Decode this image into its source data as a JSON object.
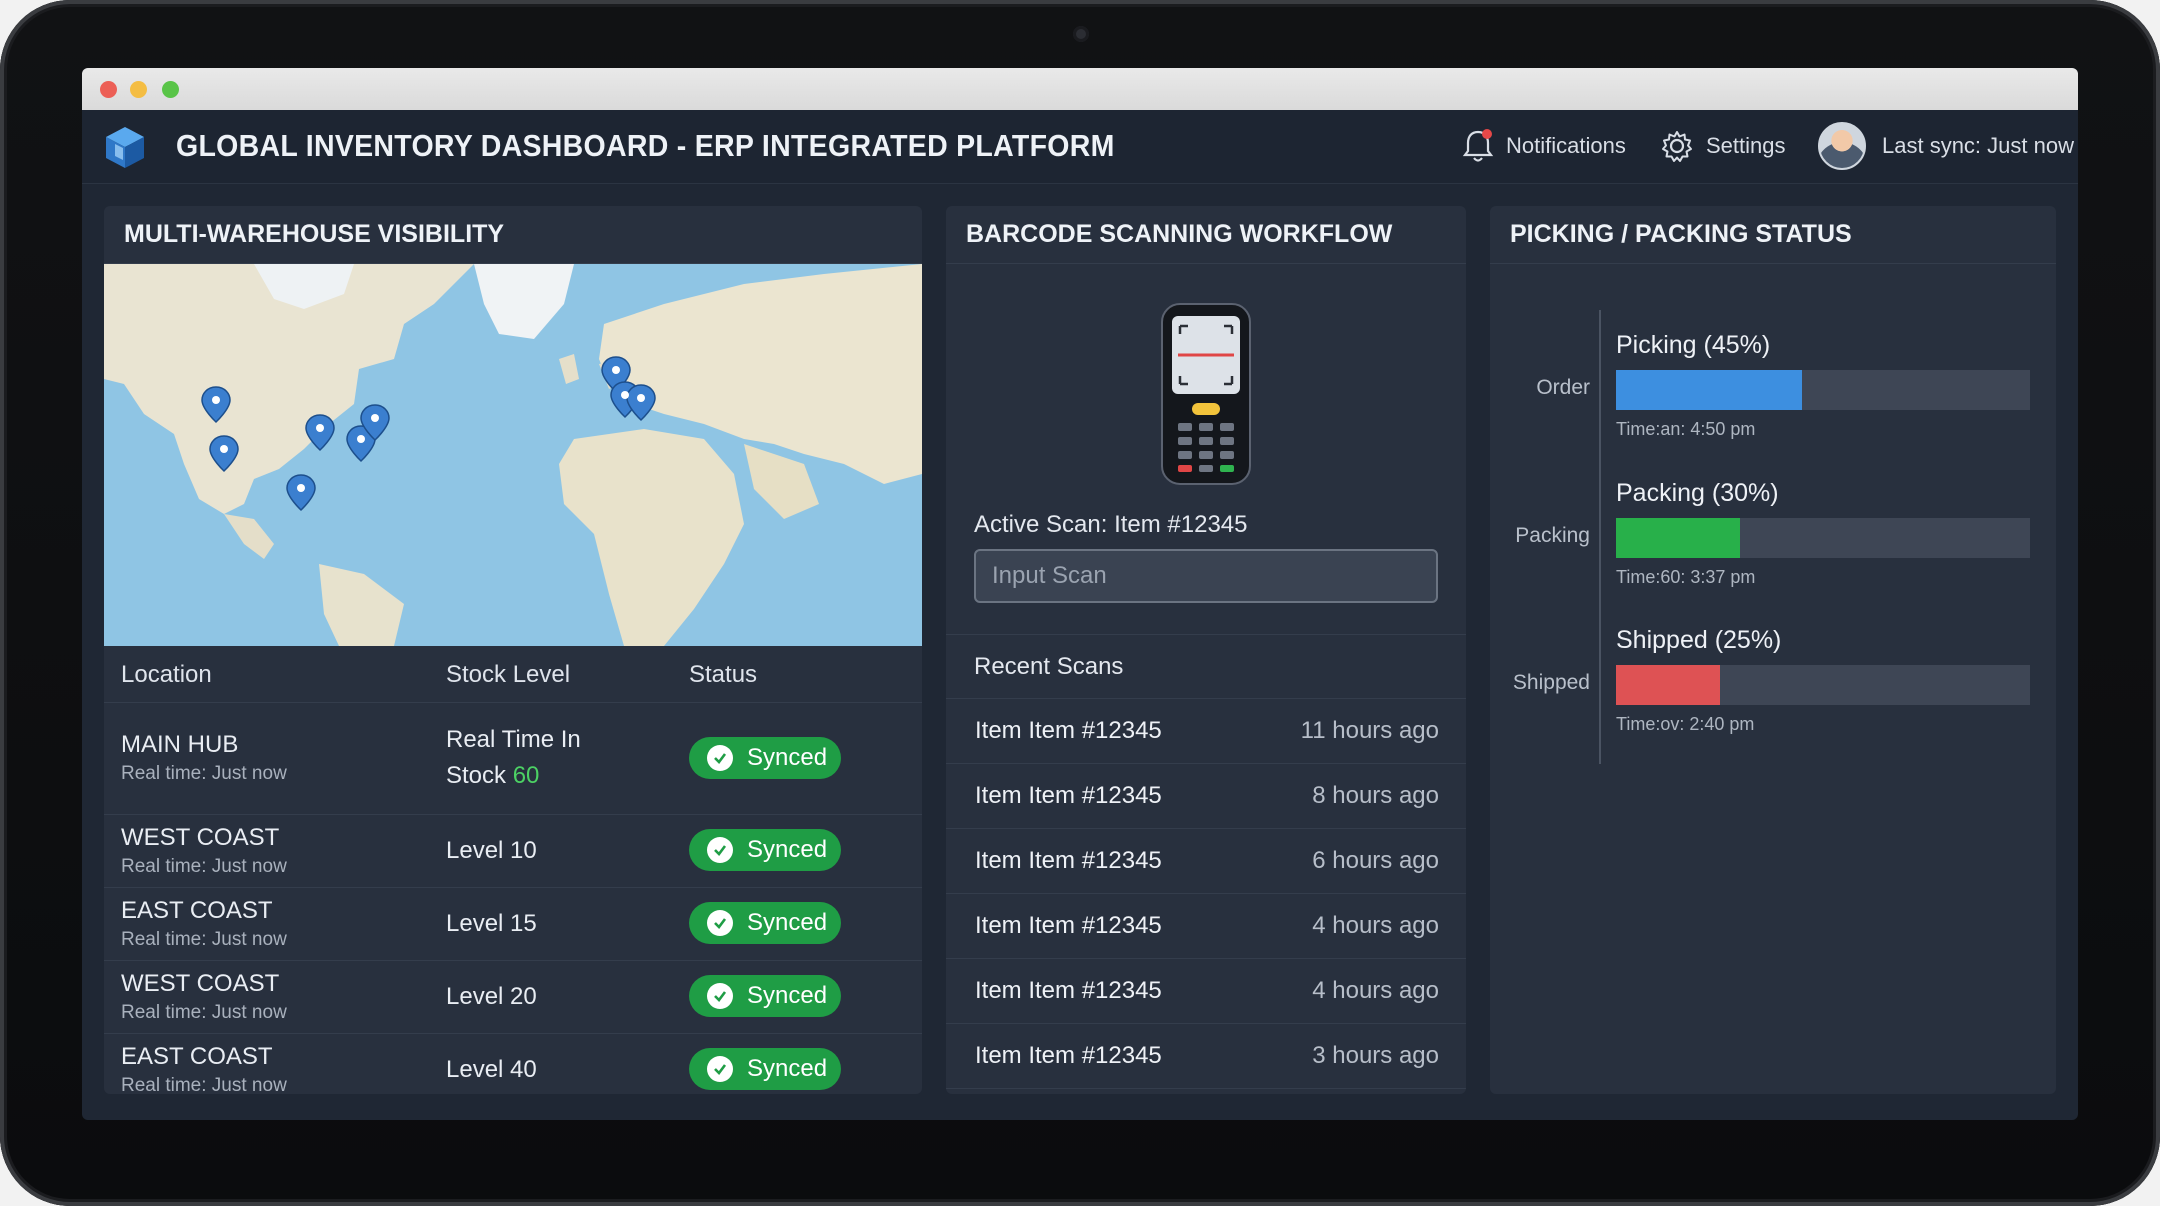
{
  "app": {
    "title": "GLOBAL INVENTORY DASHBOARD - ERP INTEGRATED PLATFORM",
    "notifications_label": "Notifications",
    "settings_label": "Settings",
    "sync_label": "Last sync: Just now"
  },
  "warehouse": {
    "title": "MULTI-WAREHOUSE VISIBILITY",
    "columns": [
      "Location",
      "Stock Level",
      "Status"
    ],
    "rows": [
      {
        "location": "MAIN HUB",
        "sub": "Real time: Just now",
        "stock_line1": "Real Time In",
        "stock_line2": "Stock",
        "stock_value": "60",
        "status": "Synced"
      },
      {
        "location": "WEST COAST",
        "sub": "Real time: Just now",
        "stock": "Level 10",
        "status": "Synced"
      },
      {
        "location": "EAST COAST",
        "sub": "Real time: Just now",
        "stock": "Level 15",
        "status": "Synced"
      },
      {
        "location": "WEST COAST",
        "sub": "Real time: Just now",
        "stock": "Level 20",
        "status": "Synced"
      },
      {
        "location": "EAST COAST",
        "sub": "Real time: Just now",
        "stock": "Level 40",
        "status": "Synced"
      }
    ]
  },
  "scanning": {
    "title": "BARCODE SCANNING WORKFLOW",
    "active_scan": "Active Scan: Item #12345",
    "input_placeholder": "Input Scan",
    "recent_title": "Recent Scans",
    "scans": [
      {
        "item": "Item Item #12345",
        "time": "11 hours ago"
      },
      {
        "item": "Item Item #12345",
        "time": "8 hours ago"
      },
      {
        "item": "Item Item #12345",
        "time": "6 hours ago"
      },
      {
        "item": "Item Item #12345",
        "time": "4 hours ago"
      },
      {
        "item": "Item Item #12345",
        "time": "4 hours ago"
      },
      {
        "item": "Item Item #12345",
        "time": "3 hours ago"
      }
    ]
  },
  "picking": {
    "title": "PICKING / PACKING STATUS",
    "categories": [
      "Order",
      "Packing",
      "Shipped"
    ],
    "bars": [
      {
        "label": "Picking (45%)",
        "value": 0.45,
        "color": "#3d8fe0",
        "time": "Time:an: 4:50 pm"
      },
      {
        "label": "Packing (30%)",
        "value": 0.3,
        "color": "#28b04a",
        "time": "Time:60: 3:37 pm"
      },
      {
        "label": "Shipped (25%)",
        "value": 0.25,
        "color": "#de5254",
        "time": "Time:ov: 2:40 pm"
      }
    ]
  },
  "colors": {
    "accent_blue": "#3d8fe0",
    "synced_green": "#1f9d45",
    "panel_bg": "#28303e"
  }
}
